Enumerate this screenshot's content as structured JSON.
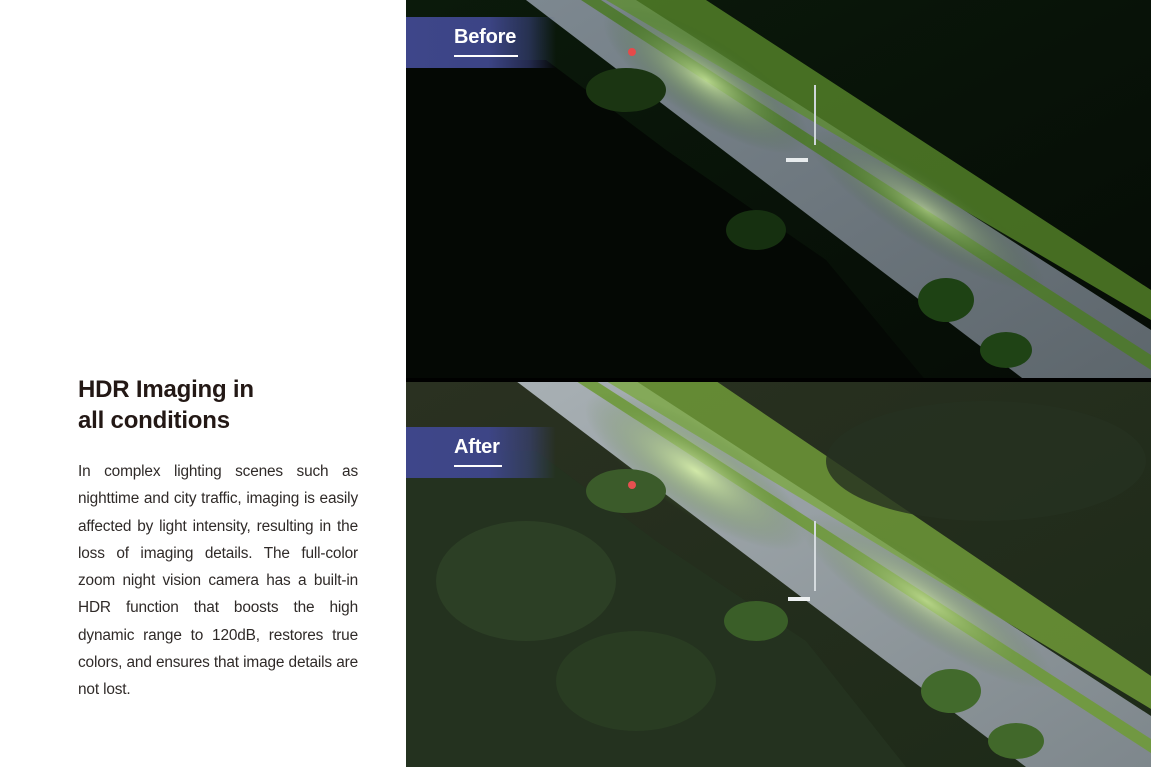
{
  "section": {
    "title_lines": [
      "HDR Imaging in",
      "all conditions"
    ],
    "body": "In complex lighting scenes such as nighttime and city traffic, imaging is easily affected by light intensity, resulting in the loss of imaging details. The full-color zoom night vision camera has a built-in HDR function that boosts the high dynamic range to 120dB, restores true colors, and ensures that image details are not lost."
  },
  "comparison": {
    "before": {
      "label": "Before",
      "image_description": "Dark nighttime aerial view of a tree-lined multi-lane road along a forested hillside, without HDR"
    },
    "after": {
      "label": "After",
      "image_description": "Same nighttime aerial road scene with HDR applied, revealing brighter details in shadows and highlights"
    }
  },
  "colors": {
    "label_background": "#3e468a",
    "label_text": "#ffffff",
    "title_text": "#231815",
    "body_text": "#2f2a28",
    "page_background": "#ffffff"
  }
}
